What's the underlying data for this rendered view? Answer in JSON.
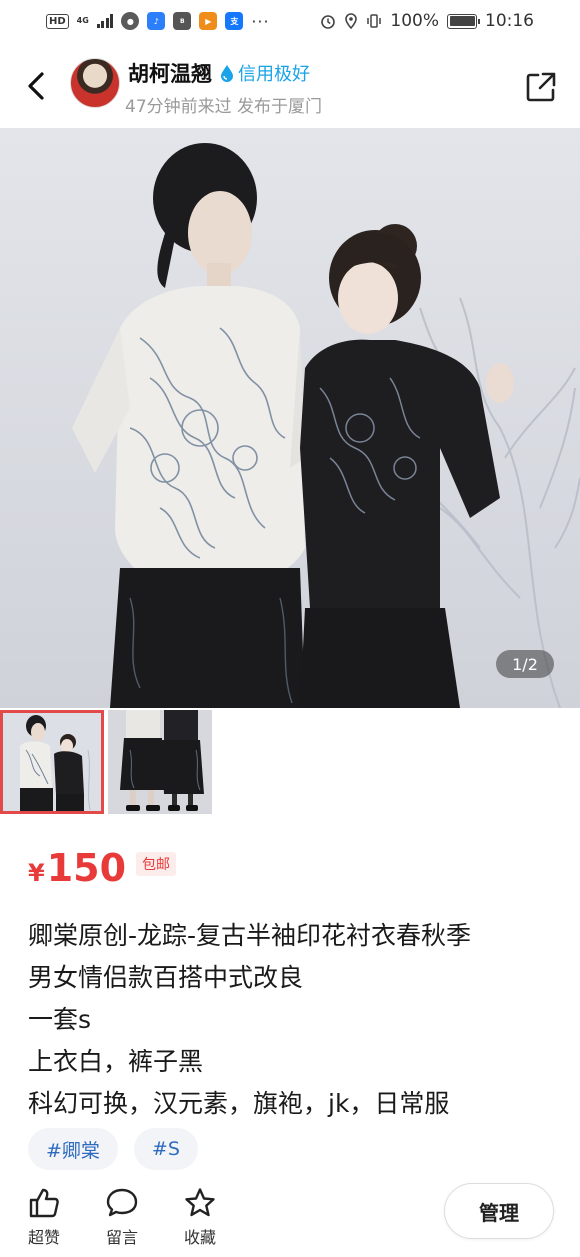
{
  "status_bar": {
    "hd": "HD",
    "network": "4G",
    "battery": "100%",
    "time": "10:16",
    "app_icons": [
      "wechat-icon",
      "music-icon",
      "boss-icon",
      "video-icon",
      "alipay-icon"
    ],
    "more": "···"
  },
  "header": {
    "seller_name": "胡柯温翘",
    "credit_label": "信用极好",
    "seller_sub": "47分钟前来过 发布于厦门",
    "back_icon": "back-arrow-icon",
    "share_icon": "share-icon"
  },
  "gallery": {
    "counter": "1/2",
    "current": 1,
    "total": 2
  },
  "price": {
    "currency": "¥",
    "amount": "150",
    "badge": "包邮"
  },
  "description": {
    "lines": [
      "卿棠原创-龙踪-复古半袖印花衬衣春秋季",
      "男女情侣款百搭中式改良",
      "一套s",
      "上衣白，裤子黑",
      "科幻可换，汉元素，旗袍，jk，日常服"
    ]
  },
  "tags": [
    "#卿棠",
    "#S"
  ],
  "bottom_bar": {
    "like_label": "超赞",
    "comment_label": "留言",
    "favorite_label": "收藏",
    "manage_label": "管理"
  },
  "colors": {
    "price_red": "#e93a3a",
    "credit_blue": "#1aa3e8",
    "tag_blue": "#2f6bbf",
    "thumb_active": "#e24a4a"
  }
}
